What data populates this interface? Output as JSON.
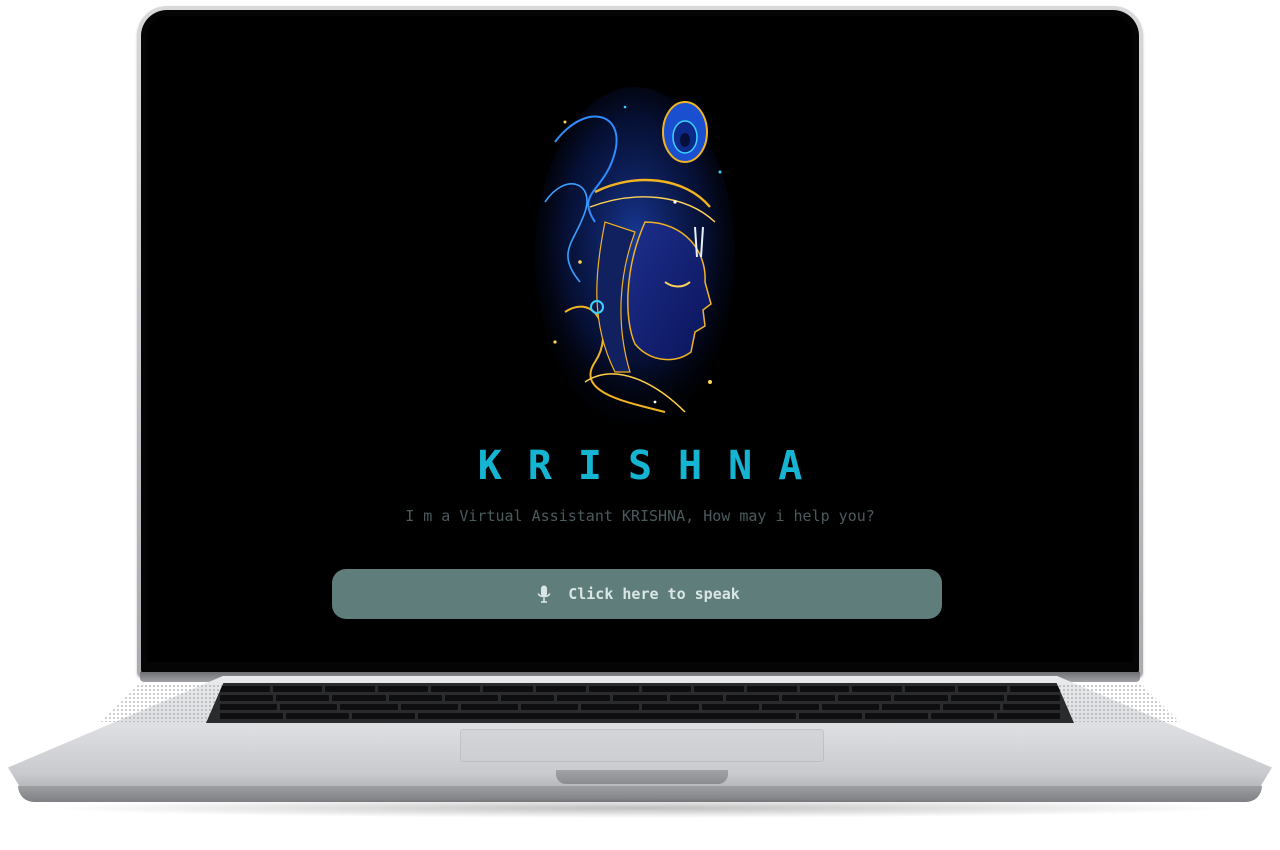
{
  "app": {
    "title": "KRISHNA",
    "subtitle": "I m a Virtual Assistant KRISHNA, How may i help you?"
  },
  "speak_button": {
    "label": "Click here to speak",
    "icon": "microphone-icon"
  },
  "colors": {
    "background": "#000000",
    "title": "#14b4d2",
    "subtitle": "#4a5a5c",
    "button_bg": "#5f7d7b",
    "button_text": "#d9e6e4",
    "artwork_gold": "#f0b323",
    "artwork_blue": "#1f5fd6"
  },
  "hero_image": {
    "subject": "glowing-portrait-artwork"
  }
}
